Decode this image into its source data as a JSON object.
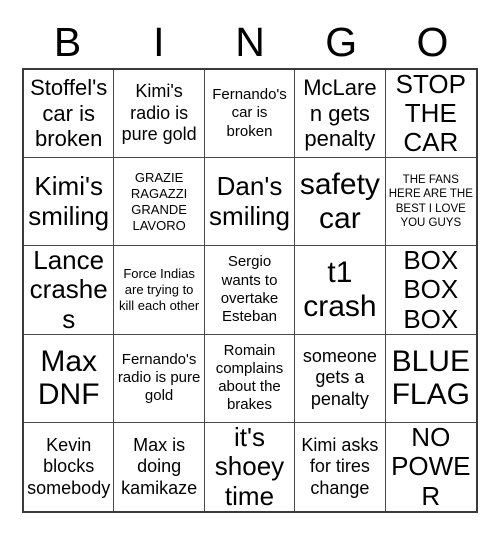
{
  "header": {
    "letters": [
      "B",
      "I",
      "N",
      "G",
      "O"
    ]
  },
  "colors": {
    "text": "#000000",
    "grid_line": "#4a4a4a",
    "grid_border": "#3a3a3a",
    "background": "#ffffff"
  },
  "grid": {
    "columns": 5,
    "rows": 5,
    "cells": [
      {
        "text": "Stoffel's car is broken",
        "size": "lg"
      },
      {
        "text": "Kimi's radio is pure gold",
        "size": "md"
      },
      {
        "text": "Fernando's car is broken",
        "size": "sm"
      },
      {
        "text": "McLaren gets penalty",
        "size": "lg"
      },
      {
        "text": "STOP THE CAR",
        "size": "xl"
      },
      {
        "text": "Kimi's smiling",
        "size": "xl"
      },
      {
        "text": "GRAZIE RAGAZZI GRANDE LAVORO",
        "size": "xs"
      },
      {
        "text": "Dan's smiling",
        "size": "xl"
      },
      {
        "text": "safety car",
        "size": "xxl"
      },
      {
        "text": "THE FANS HERE ARE THE BEST I LOVE YOU GUYS",
        "size": "xxs"
      },
      {
        "text": "Lance crashes",
        "size": "xl"
      },
      {
        "text": "Force Indias are trying to kill each other",
        "size": "xs"
      },
      {
        "text": "Sergio wants to overtake Esteban",
        "size": "sm"
      },
      {
        "text": "t1 crash",
        "size": "xxl"
      },
      {
        "text": "BOX BOX BOX",
        "size": "xl"
      },
      {
        "text": "Max DNF",
        "size": "xxl"
      },
      {
        "text": "Fernando's radio is pure gold",
        "size": "sm"
      },
      {
        "text": "Romain complains about the brakes",
        "size": "sm"
      },
      {
        "text": "someone gets a penalty",
        "size": "md"
      },
      {
        "text": "BLUE FLAG",
        "size": "xxl"
      },
      {
        "text": "Kevin blocks somebody",
        "size": "md"
      },
      {
        "text": "Max is doing kamikaze",
        "size": "md"
      },
      {
        "text": "it's shoey time",
        "size": "xl"
      },
      {
        "text": "Kimi asks for tires change",
        "size": "md"
      },
      {
        "text": "NO POWER",
        "size": "xl"
      }
    ]
  }
}
